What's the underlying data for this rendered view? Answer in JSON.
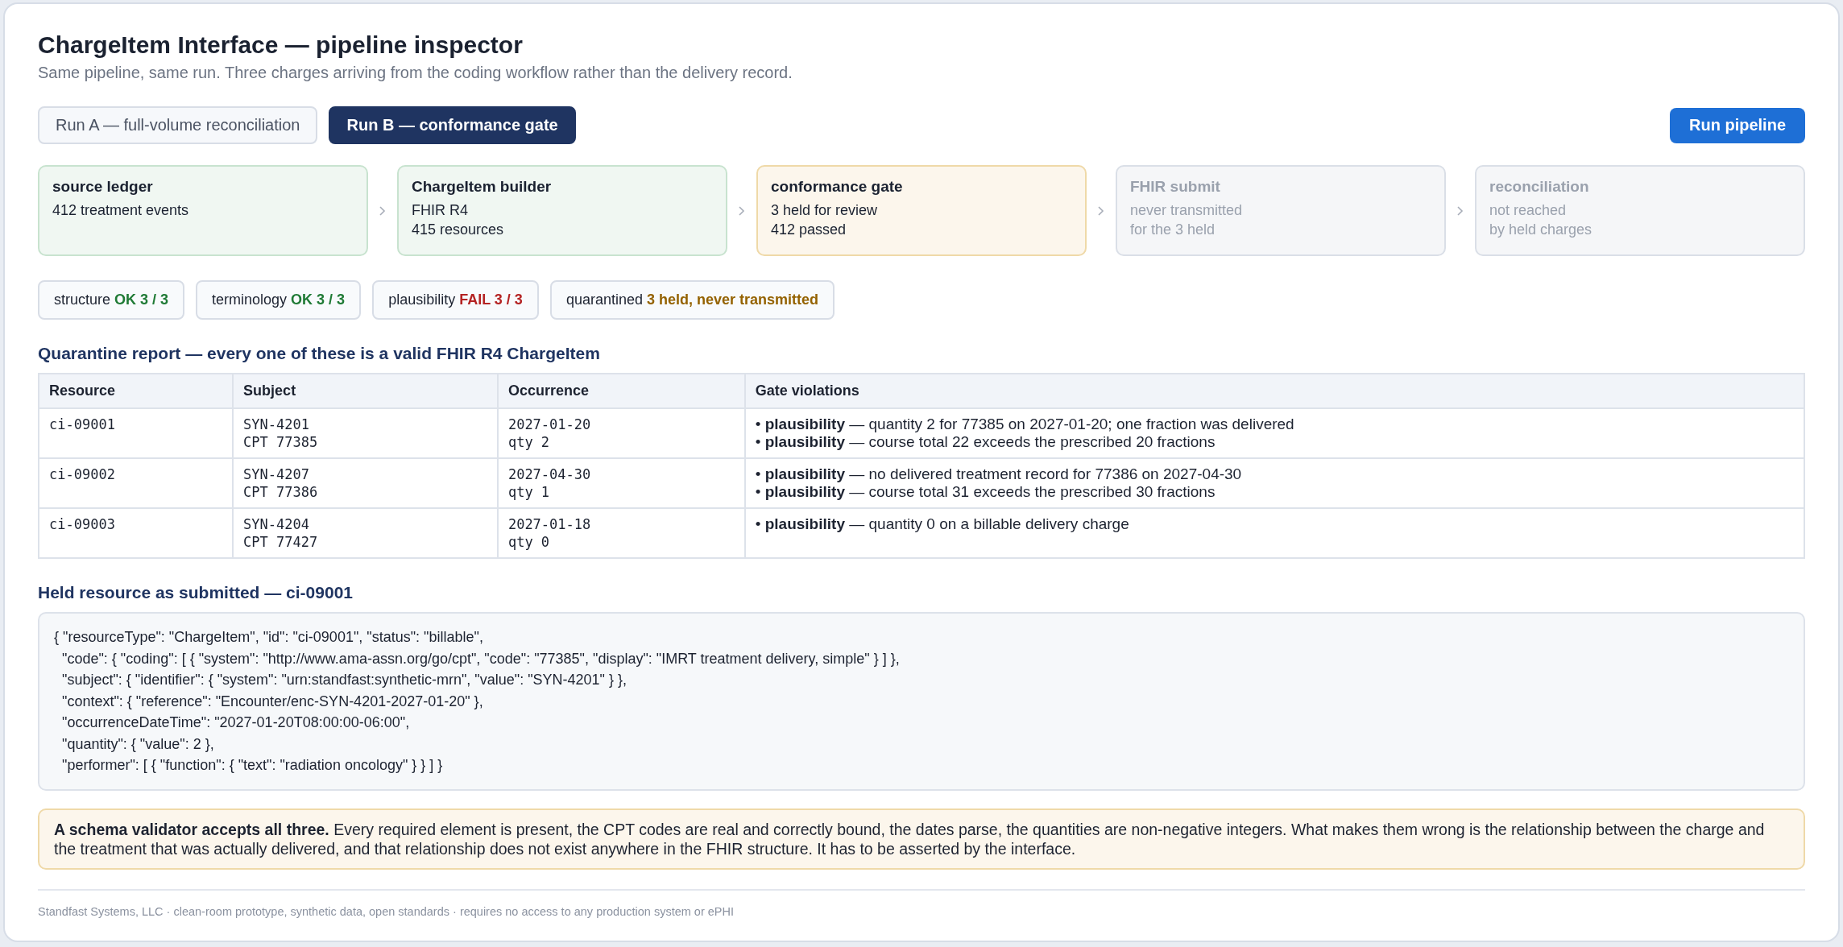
{
  "header": {
    "title": "ChargeItem Interface — pipeline inspector",
    "subtitle": "Same pipeline, same run. Three charges arriving from the coding workflow rather than the delivery record."
  },
  "tabs": [
    {
      "label": "Run A — full-volume reconciliation",
      "selected": false
    },
    {
      "label": "Run B — conformance gate",
      "selected": true
    }
  ],
  "run_button": "Run pipeline",
  "stages": [
    {
      "title": "source ledger",
      "lines": [
        "412 treatment events"
      ],
      "kind": "done"
    },
    {
      "title": "ChargeItem builder",
      "lines": [
        "FHIR R4",
        "415 resources"
      ],
      "kind": "done"
    },
    {
      "title": "conformance gate",
      "lines": [
        "3 held for review",
        "412 passed"
      ],
      "kind": "held"
    },
    {
      "title": "FHIR submit",
      "lines": [
        "never transmitted",
        "for the 3 held"
      ],
      "kind": "inactive"
    },
    {
      "title": "reconciliation",
      "lines": [
        "not reached",
        "by held charges"
      ],
      "kind": "inactive"
    }
  ],
  "checks": [
    {
      "label": "structure",
      "result": "OK 3 / 3",
      "kind": "ok"
    },
    {
      "label": "terminology",
      "result": "OK 3 / 3",
      "kind": "ok"
    },
    {
      "label": "plausibility",
      "result": "FAIL 3 / 3",
      "kind": "fail"
    },
    {
      "label": "quarantined",
      "result": "3 held, never transmitted",
      "kind": "held"
    }
  ],
  "quarantine": {
    "heading": "Quarantine report — every one of these is a valid FHIR R4 ChargeItem",
    "columns": [
      "Resource",
      "Subject",
      "Occurrence",
      "Gate violations"
    ],
    "rows": [
      {
        "resource": "ci-09001",
        "subject": [
          "SYN-4201",
          "CPT 77385"
        ],
        "occurrence": [
          "2027-01-20",
          "qty 2"
        ],
        "violations": [
          "• **plausibility** — quantity 2 for 77385 on 2027-01-20; one fraction was delivered",
          "• **plausibility** — course total 22 exceeds the prescribed 20 fractions"
        ]
      },
      {
        "resource": "ci-09002",
        "subject": [
          "SYN-4207",
          "CPT 77386"
        ],
        "occurrence": [
          "2027-04-30",
          "qty 1"
        ],
        "violations": [
          "• **plausibility** — no delivered treatment record for 77386 on 2027-04-30",
          "• **plausibility** — course total 31 exceeds the prescribed 30 fractions"
        ]
      },
      {
        "resource": "ci-09003",
        "subject": [
          "SYN-4204",
          "CPT 77427"
        ],
        "occurrence": [
          "2027-01-18",
          "qty 0"
        ],
        "violations": [
          "• **plausibility** — quantity 0 on a billable delivery charge"
        ]
      }
    ]
  },
  "held_resource": {
    "heading": "Held resource as submitted — ci-09001",
    "lines": [
      "{ \"resourceType\": \"ChargeItem\", \"id\": \"ci-09001\", \"status\": \"billable\",",
      "  \"code\": { \"coding\": [ { \"system\": \"http://www.ama-assn.org/go/cpt\", \"code\": \"77385\", \"display\": \"IMRT treatment delivery, simple\" } ] },",
      "  \"subject\": { \"identifier\": { \"system\": \"urn:standfast:synthetic-mrn\", \"value\": \"SYN-4201\" } },",
      "  \"context\": { \"reference\": \"Encounter/enc-SYN-4201-2027-01-20\" },",
      "  \"occurrenceDateTime\": \"2027-01-20T08:00:00-06:00\",",
      "  \"quantity\": { \"value\": 2 },",
      "  \"performer\": [ { \"function\": { \"text\": \"radiation oncology\" } } ] }"
    ]
  },
  "note": "**A schema validator accepts all three.** Every required element is present, the CPT codes are real and correctly bound, the dates parse, the quantities are non-negative integers. What makes them wrong is the relationship between the charge and the treatment that was actually delivered, and that relationship does not exist anywhere in the FHIR structure. It has to be asserted by the interface.",
  "footer": "Standfast Systems, LLC · clean-room prototype, synthetic data, open standards · requires no access to any production system or ePHI"
}
